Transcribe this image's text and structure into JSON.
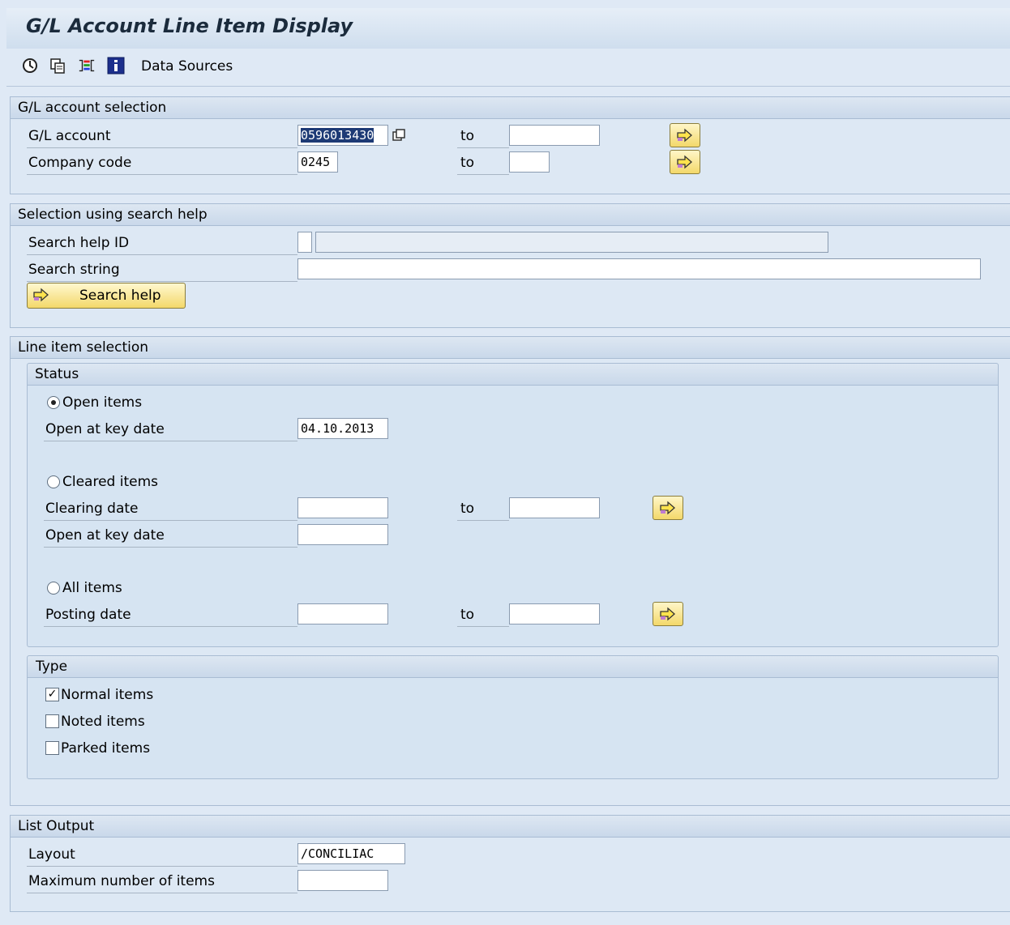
{
  "title": "G/L Account Line Item Display",
  "toolbar": {
    "icons": [
      "execute-icon",
      "copy-icon",
      "selection-options-icon",
      "info-icon"
    ],
    "data_sources_label": "Data Sources"
  },
  "gl_section": {
    "header": "G/L account selection",
    "gl_account_label": "G/L account",
    "gl_account_value": "0596013430",
    "company_code_label": "Company code",
    "company_code_value": "0245",
    "to_label": "to"
  },
  "search_section": {
    "header": "Selection using search help",
    "search_help_id_label": "Search help ID",
    "search_string_label": "Search string",
    "search_help_button": "Search help"
  },
  "line_item_section": {
    "header": "Line item selection",
    "status_header": "Status",
    "open_items_label": "Open items",
    "open_key_date_label": "Open at key date",
    "open_key_date_value": "04.10.2013",
    "cleared_items_label": "Cleared items",
    "clearing_date_label": "Clearing date",
    "cleared_open_key_date_label": "Open at key date",
    "all_items_label": "All items",
    "posting_date_label": "Posting date",
    "to_label": "to",
    "selected_status": "Open items",
    "type_header": "Type",
    "normal_items_label": "Normal items",
    "noted_items_label": "Noted items",
    "parked_items_label": "Parked items",
    "normal_items_checked": true,
    "noted_items_checked": false,
    "parked_items_checked": false
  },
  "list_output_section": {
    "header": "List Output",
    "layout_label": "Layout",
    "layout_value": "/CONCILIAC",
    "max_items_label": "Maximum number of items"
  },
  "colors": {
    "background": "#dfe9f5",
    "selected_text_bg": "#1d3a75",
    "button_yellow": "#f3d86a"
  }
}
